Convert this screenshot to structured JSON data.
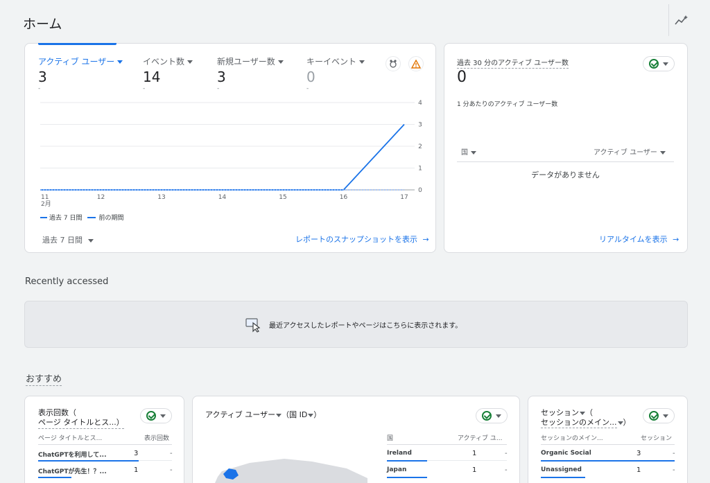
{
  "page": {
    "title": "ホーム",
    "insights_icon": "insights-sparkle-icon"
  },
  "overview_card": {
    "metrics": [
      {
        "label": "アクティブ ユーザー",
        "value": "3",
        "sub": "-"
      },
      {
        "label": "イベント数",
        "value": "14",
        "sub": "-"
      },
      {
        "label": "新規ユーザー数",
        "value": "3",
        "sub": "-"
      },
      {
        "label": "キーイベント",
        "value": "0",
        "sub": "-"
      }
    ],
    "month_label": "2月",
    "legend": {
      "current": "過去 7 日間",
      "previous": "前の期間"
    },
    "date_range": "過去 7 日間",
    "snapshot_link": "レポートのスナップショットを表示"
  },
  "chart_data": {
    "type": "line",
    "x": [
      "11",
      "12",
      "13",
      "14",
      "15",
      "16",
      "17"
    ],
    "series": [
      {
        "name": "過去 7 日間",
        "values": [
          0,
          0,
          0,
          0,
          0,
          0,
          3
        ]
      },
      {
        "name": "前の期間",
        "values": [
          0,
          0,
          0,
          0,
          0,
          0,
          0
        ]
      }
    ],
    "y_ticks": [
      "0",
      "1",
      "2",
      "3",
      "4"
    ],
    "ylim": [
      0,
      4
    ],
    "grid": true,
    "legend_position": "bottom-left"
  },
  "realtime_card": {
    "title": "過去 30 分のアクティブ ユーザー数",
    "value": "0",
    "per_minute_label": "1 分あたりのアクティブ ユーザー数",
    "col_country": "国",
    "col_users": "アクティブ ユーザー",
    "empty_text": "データがありません",
    "link": "リアルタイムを表示"
  },
  "recent": {
    "heading": "Recently accessed",
    "empty_text": "最近アクセスしたレポートやページはこちらに表示されます。"
  },
  "recommended": {
    "heading": "おすすめ",
    "card1": {
      "title_line1": "表示回数（",
      "title_line2": "ページ タイトルとス...）",
      "col1": "ページ タイトルとス...",
      "col2": "表示回数",
      "rows": [
        {
          "name": "ChatGPTを利用して...",
          "value": "3",
          "change": "-"
        },
        {
          "name": "ChatGPTが先生！？...",
          "value": "1",
          "change": "-"
        }
      ]
    },
    "card2": {
      "title": "アクティブ ユーザー",
      "title_by": "（国 ID",
      "title_end": "）",
      "col1": "国",
      "col2": "アクティブ ユ...",
      "rows": [
        {
          "name": "Ireland",
          "value": "1",
          "change": "-"
        },
        {
          "name": "Japan",
          "value": "1",
          "change": "-"
        }
      ]
    },
    "card3": {
      "title_line1": "セッション",
      "title_line1_end": "（",
      "title_line2": "セッションのメイン...",
      "title_line2_end": "）",
      "col1": "セッションのメイン...",
      "col2": "セッション",
      "rows": [
        {
          "name": "Organic Social",
          "value": "3",
          "change": "-"
        },
        {
          "name": "Unassigned",
          "value": "1",
          "change": "-"
        }
      ]
    }
  },
  "colors": {
    "accent": "#1a73e8",
    "success": "#188038",
    "warning": "#e37400"
  }
}
